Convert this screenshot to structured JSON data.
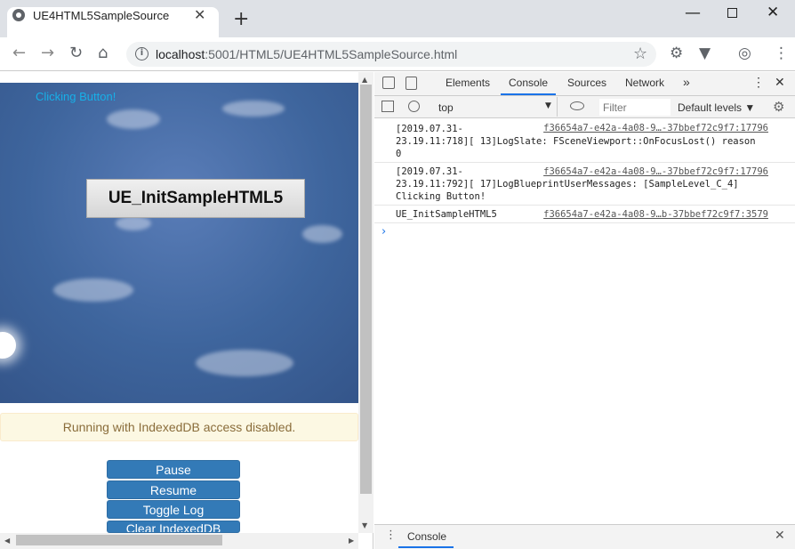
{
  "browser": {
    "tab_title": "UE4HTML5SampleSource",
    "close_tab": "✕",
    "new_tab": "+",
    "window_controls": {
      "minimize": "—",
      "maximize": "",
      "close": "✕"
    },
    "nav": {
      "back": "←",
      "forward": "→",
      "reload": "↻",
      "home": "⌂"
    },
    "url_host": "localhost",
    "url_path": ":5001/HTML5/UE4HTML5SampleSource.html",
    "info_icon": "i",
    "star": "☆",
    "extensions": [
      "⚙",
      "▼",
      "◎",
      "⋮"
    ]
  },
  "page": {
    "clicking_label": "Clicking Button!",
    "init_button": "UE_InitSampleHTML5",
    "alert": "Running with IndexedDB access disabled.",
    "buttons": [
      "Pause",
      "Resume",
      "Toggle Log",
      "Clear IndexedDB"
    ]
  },
  "devtools": {
    "tabs": [
      "Elements",
      "Console",
      "Sources",
      "Network"
    ],
    "more_tabs": "»",
    "menu": "⋮",
    "close": "✕",
    "context": "top",
    "context_arrow": "▼",
    "filter_placeholder": "Filter",
    "levels": "Default levels ▼",
    "settings": "⚙",
    "logs": [
      {
        "text": "[2019.07.31-\n23.19.11:718][ 13]LogSlate: FSceneViewport::OnFocusLost() reason\n0",
        "source": "f36654a7-e42a-4a08-9…-37bbef72c9f7:17796"
      },
      {
        "text": "[2019.07.31-\n23.19.11:792][ 17]LogBlueprintUserMessages: [SampleLevel_C_4]\nClicking Button!",
        "source": "f36654a7-e42a-4a08-9…-37bbef72c9f7:17796"
      },
      {
        "text": "UE_InitSampleHTML5",
        "source": "f36654a7-e42a-4a08-9…b-37bbef72c9f7:3579"
      }
    ],
    "prompt": "›",
    "drawer_tab": "Console",
    "drawer_menu": "⋮",
    "drawer_close": "✕"
  }
}
